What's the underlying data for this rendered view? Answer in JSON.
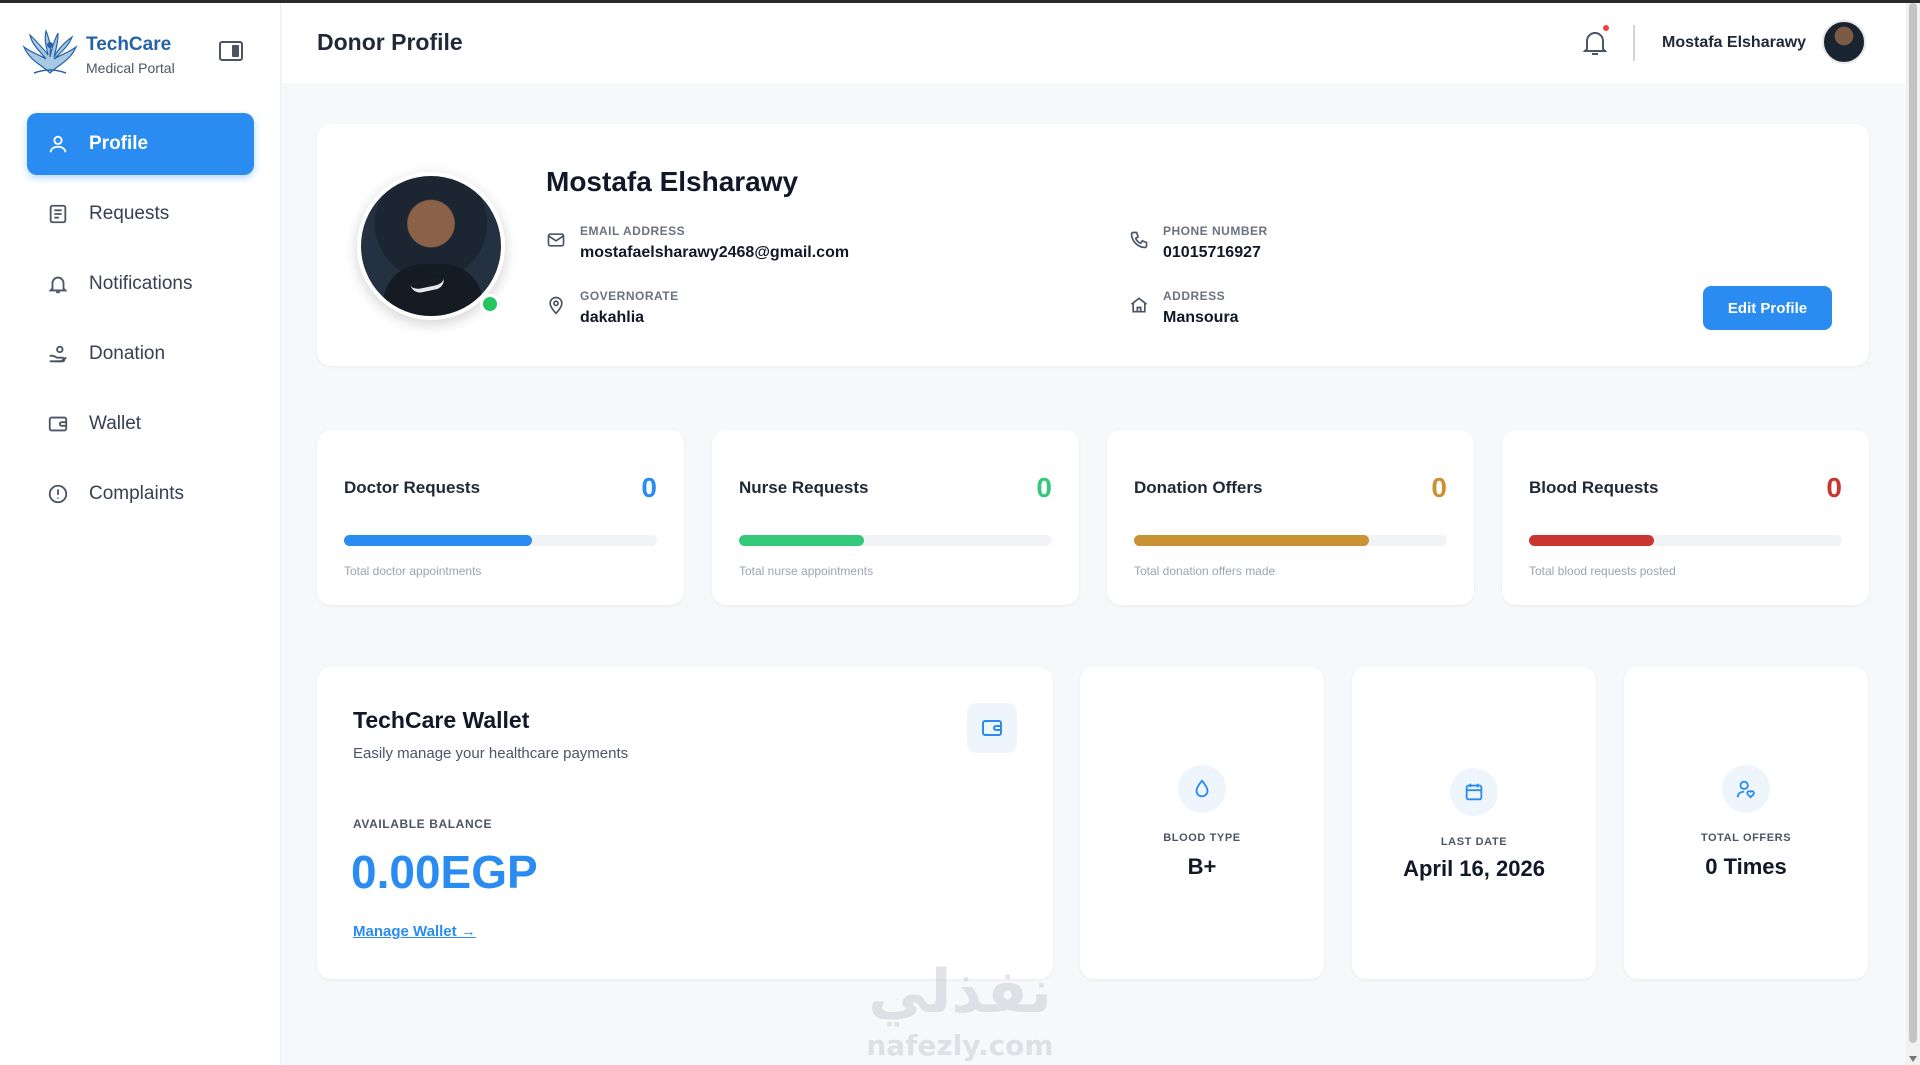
{
  "brand": {
    "title": "TechCare",
    "subtitle": "Medical Portal"
  },
  "sidebar": {
    "items": [
      {
        "label": "Profile",
        "icon": "user-icon",
        "active": true
      },
      {
        "label": "Requests",
        "icon": "document-list-icon"
      },
      {
        "label": "Notifications",
        "icon": "bell-icon"
      },
      {
        "label": "Donation",
        "icon": "hand-donation-icon"
      },
      {
        "label": "Wallet",
        "icon": "wallet-icon"
      },
      {
        "label": "Complaints",
        "icon": "alert-circle-icon"
      }
    ]
  },
  "header": {
    "title": "Donor Profile",
    "user_name": "Mostafa Elsharawy"
  },
  "profile": {
    "name": "Mostafa Elsharawy",
    "email_label": "EMAIL ADDRESS",
    "email": "mostafaelsharawy2468@gmail.com",
    "phone_label": "PHONE NUMBER",
    "phone": "01015716927",
    "governorate_label": "GOVERNORATE",
    "governorate": "dakahlia",
    "address_label": "ADDRESS",
    "address": "Mansoura",
    "edit_label": "Edit Profile",
    "online_status_color": "#22c55e"
  },
  "stats": [
    {
      "title": "Doctor Requests",
      "count": "0",
      "subtitle": "Total doctor appointments",
      "color": "#2a8cf0",
      "fill": 0.6
    },
    {
      "title": "Nurse Requests",
      "count": "0",
      "subtitle": "Total nurse appointments",
      "color": "#34c97a",
      "fill": 0.4
    },
    {
      "title": "Donation Offers",
      "count": "0",
      "subtitle": "Total donation offers made",
      "color": "#c89235",
      "fill": 0.75
    },
    {
      "title": "Blood Requests",
      "count": "0",
      "subtitle": "Total blood requests posted",
      "color": "#c9362f",
      "fill": 0.4
    }
  ],
  "wallet": {
    "title": "TechCare Wallet",
    "subtitle": "Easily manage your healthcare payments",
    "balance_label": "AVAILABLE BALANCE",
    "balance": "0.00EGP",
    "manage_link": "Manage Wallet →"
  },
  "mini_cards": [
    {
      "label": "BLOOD TYPE",
      "value": "B+",
      "icon": "blood-drop-icon"
    },
    {
      "label": "LAST DATE",
      "value": "April 16, 2026",
      "icon": "calendar-icon"
    },
    {
      "label": "TOTAL OFFERS",
      "value": "0 Times",
      "icon": "user-heart-icon"
    }
  ],
  "watermark": {
    "arabic": "نفذلي",
    "latin": "nafezly.com"
  },
  "colors": {
    "accent": "#2a8cf0",
    "brand": "#2563a8"
  }
}
